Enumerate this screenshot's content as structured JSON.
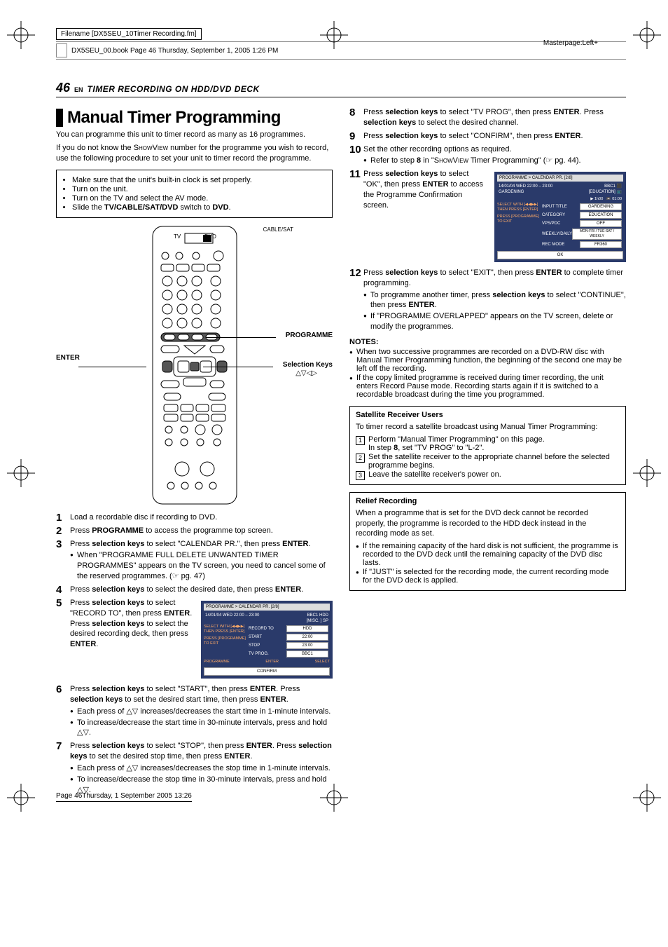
{
  "meta": {
    "filename_label": "Filename [DX5SEU_10Timer Recording.fm]",
    "book_line": "DX5SEU_00.book  Page 46  Thursday, September 1, 2005  1:26 PM",
    "masterpage": "Masterpage:Left+",
    "footer": "Page 46Thursday, 1 September 2005  13:26"
  },
  "header": {
    "page_num": "46",
    "en": "EN",
    "section_title": "TIMER RECORDING ON HDD/DVD DECK"
  },
  "heading": "Manual Timer Programming",
  "intro": {
    "p1": "You can programme this unit to timer record as many as 16 programmes.",
    "p2_pre": "If you do not know the ",
    "p2_showview": "ShowView",
    "p2_post": " number for the programme you wish to record, use the following procedure to set your unit to timer record the programme."
  },
  "prep": {
    "b1": "Make sure that the unit's built-in clock is set properly.",
    "b2": "Turn on the unit.",
    "b3": "Turn on the TV and select the AV mode.",
    "b4_pre": "Slide the ",
    "b4_bold": "TV/CABLE/SAT/DVD",
    "b4_mid": " switch to ",
    "b4_dvd": "DVD",
    "b4_post": "."
  },
  "remote_labels": {
    "enter": "ENTER",
    "programme": "PROGRAMME",
    "selkeys": "Selection Keys",
    "selkeys_sym": "△▽◁▷",
    "switch_left": "CABLE/SAT",
    "switch_tv": "TV",
    "switch_dvd": "DVD"
  },
  "steps_left": {
    "s1": "Load a recordable disc if recording to DVD.",
    "s2_pre": "Press ",
    "s2_b": "PROGRAMME",
    "s2_post": " to access the programme top screen.",
    "s3_pre": "Press ",
    "s3_b1": "selection keys",
    "s3_mid": " to select \"CALENDAR PR.\", then press ",
    "s3_b2": "ENTER",
    "s3_post": ".",
    "s3_sub1": "When \"PROGRAMME FULL DELETE UNWANTED TIMER PROGRAMMES\" appears on the TV screen, you need to cancel some of the reserved programmes. (☞ pg. 47)",
    "s4_pre": "Press ",
    "s4_b1": "selection keys",
    "s4_mid": " to select the desired date, then press ",
    "s4_b2": "ENTER",
    "s4_post": ".",
    "s5_pre": "Press ",
    "s5_b1": "selection keys",
    "s5_mid1": " to select \"RECORD TO\", then press ",
    "s5_b2": "ENTER",
    "s5_mid2": ". Press ",
    "s5_b3": "selection keys",
    "s5_mid3": " to select the desired recording deck, then press ",
    "s5_b4": "ENTER",
    "s5_post": ".",
    "s6_pre": "Press ",
    "s6_b1": "selection keys",
    "s6_mid1": " to select \"START\", then press ",
    "s6_b2": "ENTER",
    "s6_mid2": ". Press ",
    "s6_b3": "selection keys",
    "s6_mid3": " to set the desired start time, then press ",
    "s6_b4": "ENTER",
    "s6_post": ".",
    "s6_sub1_pre": "Each press of ",
    "s6_sub1_sym": "△▽",
    "s6_sub1_post": " increases/decreases the start time in 1-minute intervals.",
    "s6_sub2_pre": "To increase/decrease the start time in 30-minute intervals, press and hold ",
    "s6_sub2_sym": "△▽",
    "s6_sub2_post": ".",
    "s7_pre": "Press ",
    "s7_b1": "selection keys",
    "s7_mid1": " to select \"STOP\", then press ",
    "s7_b2": "ENTER",
    "s7_mid2": ". Press ",
    "s7_b3": "selection keys",
    "s7_mid3": " to set the desired stop time, then press ",
    "s7_b4": "ENTER",
    "s7_post": ".",
    "s7_sub1_pre": "Each press of ",
    "s7_sub1_sym": "△▽",
    "s7_sub1_post": " increases/decreases the stop time in 1-minute intervals.",
    "s7_sub2_pre": "To increase/decrease the stop time in 30-minute intervals, press and hold ",
    "s7_sub2_sym": "△▽",
    "s7_sub2_post": "."
  },
  "osd1": {
    "crumb": "PROGRAMME > CALENDAR PR. [2/8]",
    "date": "14/01/04 WED 22:00 – 23:00",
    "ch": "BBC1",
    "disc_hdd": "HDD",
    "disc_misc": "[MISC. ]",
    "mode": "SP",
    "side1": "SELECT WITH [◀◀▶▶] THEN PRESS [ENTER]",
    "side2": "PRESS [PROGRAMME] TO EXIT",
    "rows": {
      "record_to": "RECORD TO",
      "record_to_v": "HDD",
      "start": "START",
      "start_v": "22:00",
      "stop": "STOP",
      "stop_v": "23:00",
      "tvprog": "TV PROG.",
      "tvprog_v": "BBC1"
    },
    "footer_l": "PROGRAMME",
    "footer_c": "ENTER",
    "footer_r": "SELECT",
    "confirm": "CONFIRM"
  },
  "steps_right": {
    "s8_pre": "Press ",
    "s8_b1": "selection keys",
    "s8_mid1": " to select \"TV PROG\", then press ",
    "s8_b2": "ENTER",
    "s8_mid2": ". Press ",
    "s8_b3": "selection keys",
    "s8_post": " to select the desired channel.",
    "s9_pre": "Press ",
    "s9_b1": "selection keys",
    "s9_mid": " to select \"CONFIRM\", then press ",
    "s9_b2": "ENTER",
    "s9_post": ".",
    "s10": "Set the other recording options as required.",
    "s10_sub_pre": "Refer to step ",
    "s10_sub_b": "8",
    "s10_sub_mid": " in \"",
    "s10_sub_sv": "ShowView",
    "s10_sub_post": " Timer Programming\" (☞ pg. 44).",
    "s11_pre": "Press ",
    "s11_b1": "selection keys",
    "s11_mid1": " to select \"OK\", then press ",
    "s11_b2": "ENTER",
    "s11_post": " to access the Programme Confirmation screen.",
    "s12_pre": "Press ",
    "s12_b1": "selection keys",
    "s12_mid": " to select \"EXIT\", then press ",
    "s12_b2": "ENTER",
    "s12_post": " to complete timer programming.",
    "s12_sub1_pre": "To programme another timer, press ",
    "s12_sub1_b": "selection keys",
    "s12_sub1_mid": " to select \"CONTINUE\", then press ",
    "s12_sub1_b2": "ENTER",
    "s12_sub1_post": ".",
    "s12_sub2": "If \"PROGRAMME OVERLAPPED\" appears on the TV screen, delete or modify the programmes."
  },
  "osd2": {
    "crumb": "PROGRAMME > CALENDAR PR. [2/8]",
    "date": "14/01/04 WED 22:00 – 23:00",
    "title": "GARDENING",
    "ch": "BBC1",
    "cat": "[EDUCATION]",
    "rec": "01:00",
    "rec_left": "1h00",
    "side1": "SELECT WITH [◀◀▶▶] THEN PRESS [ENTER]",
    "side2": "PRESS [PROGRAMME] TO EXIT",
    "rows": {
      "input_title": "INPUT TITLE",
      "input_title_v": "GARDENING",
      "category": "CATEGORY",
      "category_v": "EDUCATION",
      "vpspdc": "VPS/PDC",
      "vpspdc_v": "OFF",
      "weekly": "WEEKLY/DAILY",
      "weekly_v": "MON-FRI / TUE-SAT / WEEKLY",
      "recmode": "REC MODE",
      "recmode_v": "FR360"
    },
    "ok": "OK"
  },
  "notes": {
    "heading": "NOTES:",
    "n1": "When two successive programmes are recorded on a DVD-RW disc with Manual Timer Programming function, the beginning of the second one may be left off the recording.",
    "n2": "If the copy limited programme is received during timer recording, the unit enters Record Pause mode. Recording starts again if it is switched to a recordable broadcast during the time you programmed."
  },
  "sat_box": {
    "heading": "Satellite Receiver Users",
    "intro": "To timer record a satellite broadcast using Manual Timer Programming:",
    "s1_pre": "Perform \"Manual Timer Programming\" on this page.",
    "s1_line2_pre": "In step ",
    "s1_line2_b": "8",
    "s1_line2_post": ", set \"TV PROG\" to \"L-2\".",
    "s2": "Set the satellite receiver to the appropriate channel before the selected programme begins.",
    "s3": "Leave the satellite receiver's power on."
  },
  "relief_box": {
    "heading": "Relief Recording",
    "p1": "When a programme that is set for the DVD deck cannot be recorded properly, the programme is recorded to the HDD deck instead in the recording mode as set.",
    "b1": "If the remaining capacity of the hard disk is not sufficient, the programme is recorded to the DVD deck until the remaining capacity of the DVD disc lasts.",
    "b2": "If \"JUST\" is selected for the recording mode, the current recording mode for the DVD deck is applied."
  }
}
